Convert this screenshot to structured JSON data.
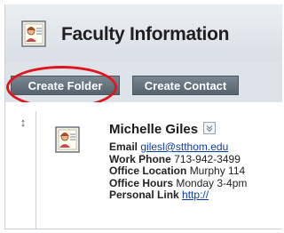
{
  "header": {
    "title": "Faculty Information",
    "icon": "contact-card-icon"
  },
  "toolbar": {
    "create_folder_label": "Create Folder",
    "create_contact_label": "Create Contact",
    "highlight_color": "#e0141c"
  },
  "contact": {
    "name": "Michelle Giles",
    "icon": "contact-card-icon",
    "email_label": "Email",
    "email_value": "gilesl@stthom.edu",
    "work_phone_label": "Work Phone",
    "work_phone_value": "713-942-3499",
    "office_location_label": "Office Location",
    "office_location_value": "Murphy 114",
    "office_hours_label": "Office Hours",
    "office_hours_value": "Monday 3-4pm",
    "personal_link_label": "Personal Link",
    "personal_link_value": "http://"
  },
  "colors": {
    "button_bg": "#5f6b75",
    "header_bg": "#e3e8ec",
    "link": "#0a3c9e"
  }
}
